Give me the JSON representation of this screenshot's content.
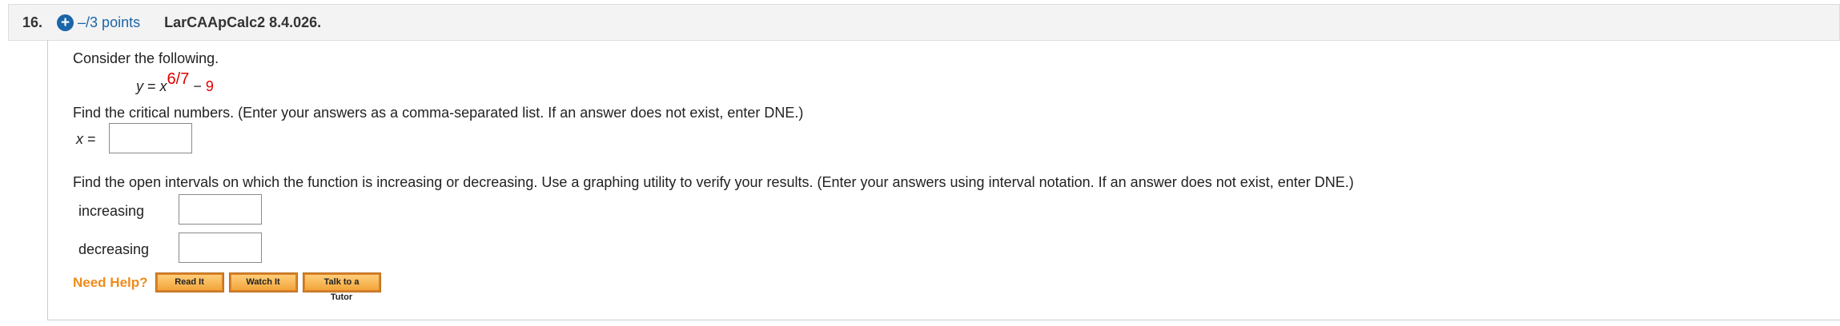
{
  "header": {
    "number": "16.",
    "points": "–/3 points",
    "source": "LarCAApCalc2 8.4.026.",
    "plus_icon": "plus-circle-icon"
  },
  "body": {
    "intro": "Consider the following.",
    "equation": {
      "lhs": "y",
      "equals": " = ",
      "base": "x",
      "exponent": "6/7",
      "minus": " − ",
      "constant": "9"
    },
    "part1_prompt": "Find the critical numbers. (Enter your answers as a comma-separated list. If an answer does not exist, enter DNE.)",
    "part1_label_var": "x",
    "part1_label_eq": " =",
    "part1_value": "",
    "part2_prompt": "Find the open intervals on which the function is increasing or decreasing. Use a graphing utility to verify your results. (Enter your answers using interval notation. If an answer does not exist, enter DNE.)",
    "increasing_label": "increasing",
    "increasing_value": "",
    "decreasing_label": "decreasing",
    "decreasing_value": ""
  },
  "help": {
    "label": "Need Help?",
    "buttons": [
      "Read It",
      "Watch It",
      "Talk to a Tutor"
    ]
  },
  "colors": {
    "accent_blue": "#1a66a8",
    "highlight_red": "#e00000",
    "help_orange": "#f08a1c"
  }
}
